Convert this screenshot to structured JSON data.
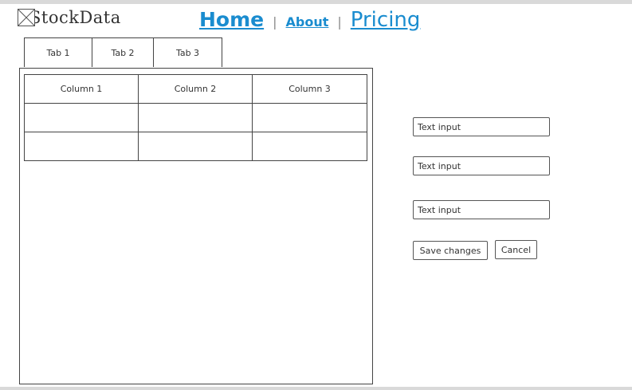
{
  "header": {
    "logo_text": "StockData",
    "nav": {
      "home": "Home",
      "about": "About",
      "pricing": "Pricing",
      "separator": "|"
    }
  },
  "tabs": [
    {
      "label": "Tab 1"
    },
    {
      "label": "Tab 2"
    },
    {
      "label": "Tab 3"
    }
  ],
  "table": {
    "columns": [
      "Column 1",
      "Column 2",
      "Column 3"
    ],
    "rows": [
      [
        "",
        "",
        ""
      ],
      [
        "",
        "",
        ""
      ]
    ]
  },
  "form": {
    "fields": [
      {
        "placeholder": "Text input",
        "value": ""
      },
      {
        "placeholder": "Text input",
        "value": ""
      },
      {
        "placeholder": "Text input",
        "value": ""
      }
    ],
    "save_label": "Save changes",
    "cancel_label": "Cancel"
  },
  "colors": {
    "link": "#1a8ccf",
    "border": "#444444",
    "text": "#333333",
    "frame": "#d9d9d9"
  },
  "icons": {
    "logo": "image-placeholder-icon"
  }
}
